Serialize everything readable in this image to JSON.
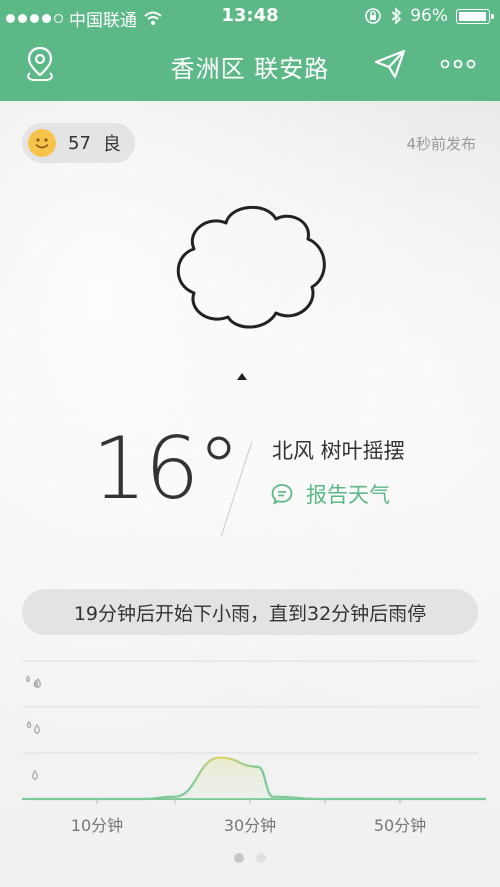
{
  "status_bar": {
    "carrier": "中国联通",
    "time": "13:48",
    "battery": "96%",
    "battery_level": 0.96
  },
  "header": {
    "title": "香洲区 联安路"
  },
  "aqi": {
    "value": "57",
    "level": "良"
  },
  "published": "4秒前发布",
  "weather": {
    "temperature": "16°",
    "wind": "北风 树叶摇摆",
    "report_label": "报告天气"
  },
  "forecast": "19分钟后开始下小雨，直到32分钟后雨停",
  "colors": {
    "accent": "#5cb887",
    "curve": "#7cc896",
    "curve_highlight": "#e2d56c"
  },
  "chart_data": {
    "type": "area",
    "x_ticks": [
      "10分钟",
      "30分钟",
      "50分钟"
    ],
    "y_levels": [
      "小雨",
      "中雨",
      "大雨"
    ],
    "x": [
      0,
      10,
      15,
      19,
      25,
      30,
      32,
      38,
      45,
      50,
      60
    ],
    "values": [
      0,
      0,
      0,
      0.05,
      0.9,
      0.7,
      0.05,
      0,
      0,
      0,
      0
    ],
    "ylim": [
      0,
      3
    ],
    "grid": true
  }
}
